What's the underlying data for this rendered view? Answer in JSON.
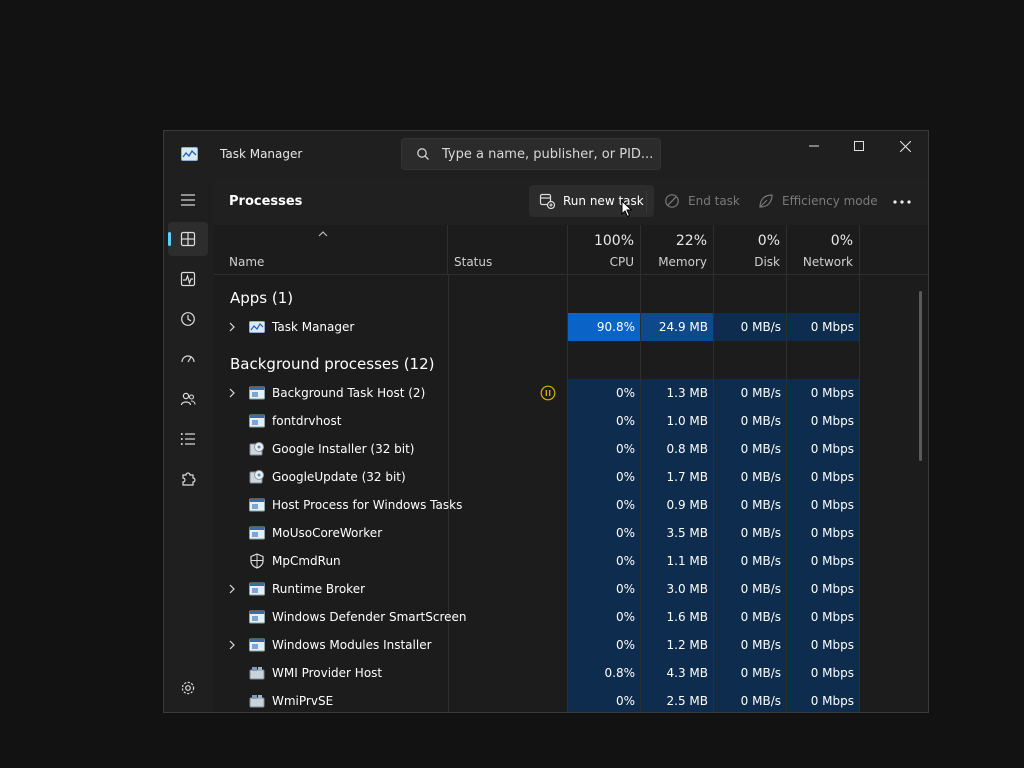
{
  "window": {
    "title": "Task Manager"
  },
  "search": {
    "placeholder": "Type a name, publisher, or PID..."
  },
  "toolbar": {
    "page_title": "Processes",
    "run_new_task": "Run new task",
    "end_task": "End task",
    "efficiency_mode": "Efficiency mode"
  },
  "columns": {
    "name": "Name",
    "status": "Status",
    "cpu": {
      "pct": "100%",
      "label": "CPU"
    },
    "memory": {
      "pct": "22%",
      "label": "Memory"
    },
    "disk": {
      "pct": "0%",
      "label": "Disk"
    },
    "network": {
      "pct": "0%",
      "label": "Network"
    }
  },
  "groups": {
    "apps": "Apps (1)",
    "background": "Background processes (12)"
  },
  "apps": [
    {
      "name": "Task Manager",
      "cpu": "90.8%",
      "memory": "24.9 MB",
      "disk": "0 MB/s",
      "network": "0 Mbps"
    }
  ],
  "background": [
    {
      "name": "Background Task Host (2)",
      "cpu": "0%",
      "memory": "1.3 MB",
      "disk": "0 MB/s",
      "network": "0 Mbps"
    },
    {
      "name": "fontdrvhost",
      "cpu": "0%",
      "memory": "1.0 MB",
      "disk": "0 MB/s",
      "network": "0 Mbps"
    },
    {
      "name": "Google Installer (32 bit)",
      "cpu": "0%",
      "memory": "0.8 MB",
      "disk": "0 MB/s",
      "network": "0 Mbps"
    },
    {
      "name": "GoogleUpdate (32 bit)",
      "cpu": "0%",
      "memory": "1.7 MB",
      "disk": "0 MB/s",
      "network": "0 Mbps"
    },
    {
      "name": "Host Process for Windows Tasks",
      "cpu": "0%",
      "memory": "0.9 MB",
      "disk": "0 MB/s",
      "network": "0 Mbps"
    },
    {
      "name": "MoUsoCoreWorker",
      "cpu": "0%",
      "memory": "3.5 MB",
      "disk": "0 MB/s",
      "network": "0 Mbps"
    },
    {
      "name": "MpCmdRun",
      "cpu": "0%",
      "memory": "1.1 MB",
      "disk": "0 MB/s",
      "network": "0 Mbps"
    },
    {
      "name": "Runtime Broker",
      "cpu": "0%",
      "memory": "3.0 MB",
      "disk": "0 MB/s",
      "network": "0 Mbps"
    },
    {
      "name": "Windows Defender SmartScreen",
      "cpu": "0%",
      "memory": "1.6 MB",
      "disk": "0 MB/s",
      "network": "0 Mbps"
    },
    {
      "name": "Windows Modules Installer",
      "cpu": "0%",
      "memory": "1.2 MB",
      "disk": "0 MB/s",
      "network": "0 Mbps"
    },
    {
      "name": "WMI Provider Host",
      "cpu": "0.8%",
      "memory": "4.3 MB",
      "disk": "0 MB/s",
      "network": "0 Mbps"
    },
    {
      "name": "WmiPrvSE",
      "cpu": "0%",
      "memory": "2.5 MB",
      "disk": "0 MB/s",
      "network": "0 Mbps"
    }
  ],
  "colors": {
    "accent": "#60cdff",
    "cpu_hot": "#0a64c8",
    "mem_warm": "#0e4a8a",
    "heat_low": "#0d2c4e",
    "status_paused": "#d9b000"
  }
}
